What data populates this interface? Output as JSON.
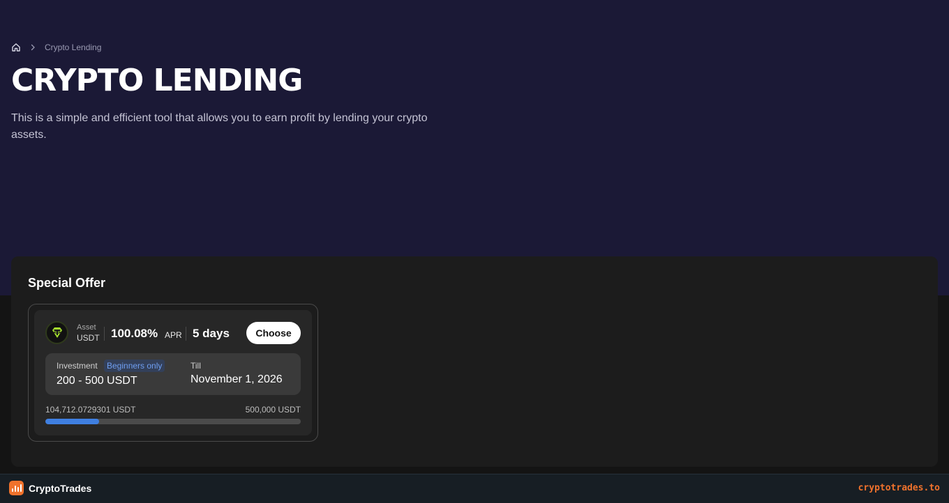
{
  "breadcrumb": {
    "home_icon": "home-icon",
    "separator_icon": "chevron-right-icon",
    "current": "Crypto Lending"
  },
  "page": {
    "title": "CRYPTO LENDING",
    "description": "This is a simple and efficient tool that allows you to earn profit by lending your crypto assets."
  },
  "special_offer": {
    "heading": "Special Offer",
    "card": {
      "coin_icon": "tether-usdt-icon",
      "asset_label": "Asset",
      "asset_value": "USDT",
      "apr_value": "100.08%",
      "apr_label": "APR",
      "duration": "5 days",
      "choose_label": "Choose",
      "investment_label": "Investment",
      "badge": "Beginners only",
      "investment_range": "200 - 500 USDT",
      "till_label": "Till",
      "till_date": "November 1, 2026",
      "progress_current": "104,712.0729301 USDT",
      "progress_total": "500,000 USDT",
      "progress_fraction": 0.2094
    }
  },
  "footer": {
    "brand_icon": "bar-chart-icon",
    "brand_name": "CryptoTrades",
    "url": "cryptotrades.to"
  },
  "colors": {
    "hero_bg": "#1b1936",
    "accent_orange": "#f0722c",
    "progress_blue": "#3f7fe0",
    "badge_text": "#6f9ef0"
  }
}
